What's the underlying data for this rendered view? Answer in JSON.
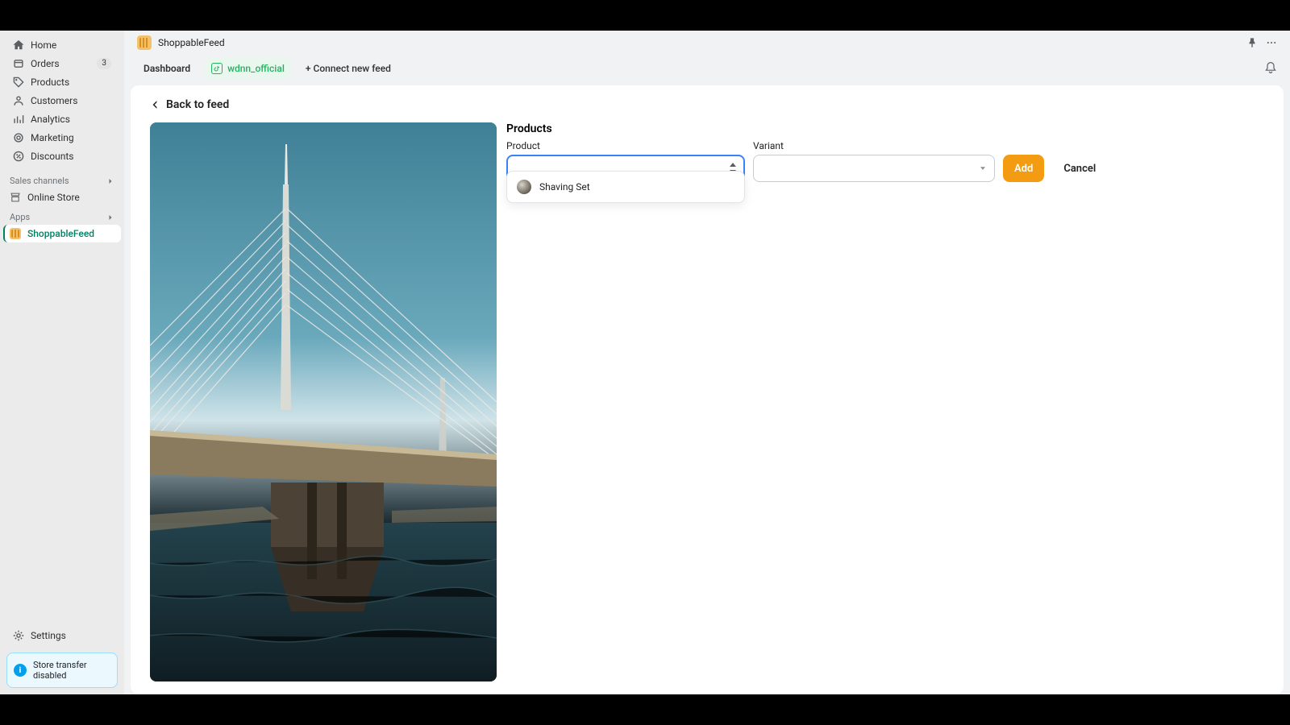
{
  "sidebar": {
    "nav": [
      {
        "label": "Home",
        "icon": "home"
      },
      {
        "label": "Orders",
        "icon": "orders",
        "badge": "3"
      },
      {
        "label": "Products",
        "icon": "products"
      },
      {
        "label": "Customers",
        "icon": "customers"
      },
      {
        "label": "Analytics",
        "icon": "analytics"
      },
      {
        "label": "Marketing",
        "icon": "marketing"
      },
      {
        "label": "Discounts",
        "icon": "discounts"
      }
    ],
    "sections": {
      "sales": "Sales channels",
      "apps": "Apps"
    },
    "online_store": "Online Store",
    "app_item": "ShoppableFeed",
    "settings": "Settings",
    "banner": "Store transfer disabled"
  },
  "header": {
    "app_title": "ShoppableFeed"
  },
  "tabs": {
    "dashboard": "Dashboard",
    "feed_name": "wdnn_official",
    "connect": "+ Connect new feed"
  },
  "content": {
    "back": "Back to feed",
    "products_heading": "Products",
    "product_label": "Product",
    "variant_label": "Variant",
    "add_btn": "Add",
    "cancel_btn": "Cancel",
    "dropdown_item": "Shaving Set"
  }
}
